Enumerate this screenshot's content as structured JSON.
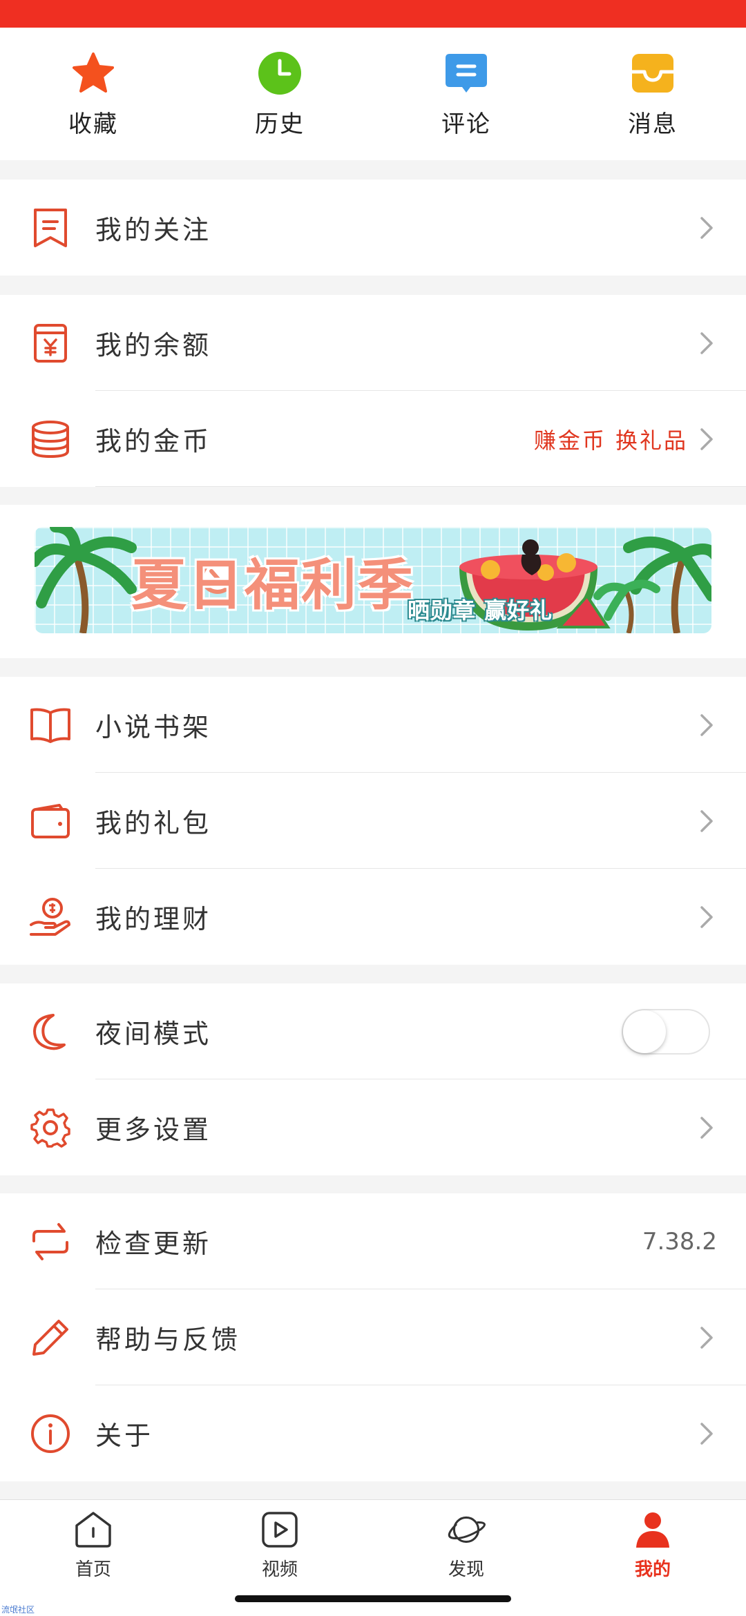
{
  "quick_actions": [
    {
      "label": "收藏",
      "icon": "star-icon",
      "color": "#f4511e"
    },
    {
      "label": "历史",
      "icon": "clock-icon",
      "color": "#5cc21a"
    },
    {
      "label": "评论",
      "icon": "comment-icon",
      "color": "#3e9ae8"
    },
    {
      "label": "消息",
      "icon": "inbox-icon",
      "color": "#f5b21d"
    }
  ],
  "menu": {
    "follow": "我的关注",
    "balance": "我的余额",
    "coins": "我的金币",
    "coins_promo": "赚金币 换礼品",
    "bookshelf": "小说书架",
    "gift": "我的礼包",
    "finance": "我的理财",
    "night_mode": "夜间模式",
    "night_mode_on": false,
    "more_settings": "更多设置",
    "check_update": "检查更新",
    "version": "7.38.2",
    "help": "帮助与反馈",
    "about": "关于"
  },
  "banner": {
    "title": "夏日福利季",
    "subtitle": "晒勋章 赢好礼"
  },
  "tabs": [
    {
      "label": "首页",
      "icon": "home-icon"
    },
    {
      "label": "视频",
      "icon": "video-play-icon"
    },
    {
      "label": "发现",
      "icon": "planet-icon"
    },
    {
      "label": "我的",
      "icon": "person-icon",
      "active": true
    }
  ],
  "watermark": "流氓社区",
  "colors": {
    "accent": "#e8321e",
    "status_bar": "#ef2f22",
    "icon_line": "#e04a2e"
  }
}
